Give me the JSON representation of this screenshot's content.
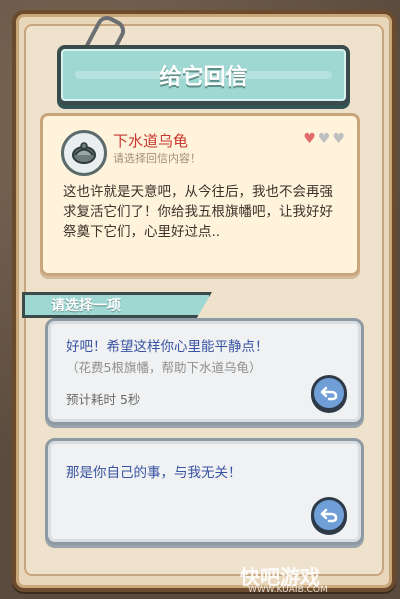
{
  "dialog": {
    "title": "给它回信"
  },
  "letter": {
    "sender_name": "下水道乌龟",
    "prompt": "请选择回信内容！",
    "hearts": [
      "filled",
      "empty",
      "empty"
    ],
    "heart_colors": {
      "filled": "#e26b6b",
      "empty": "#bfbfbf"
    },
    "body": "这也许就是天意吧，从今往后，我也不会再强求复活它们了！你给我五根旗幡吧，让我好好祭奠下它们，心里好过点.."
  },
  "choose": {
    "label": "请选择一项"
  },
  "options": [
    {
      "main": "好吧！希望这样你心里能平静点！",
      "sub": "（花费5根旗幡，帮助下水道乌龟）",
      "time": "预计耗时  5秒",
      "icon": "undo-arrow-icon"
    },
    {
      "main": "那是你自己的事，与我无关！",
      "icon": "undo-arrow-icon"
    }
  ],
  "watermark": {
    "text": "快吧游戏",
    "url": "WWW.KUAIB.COM"
  },
  "colors": {
    "accent": "#9fd7d3",
    "sender": "#c8392f",
    "option_text": "#3853a3",
    "button": "#6f9fd6"
  }
}
